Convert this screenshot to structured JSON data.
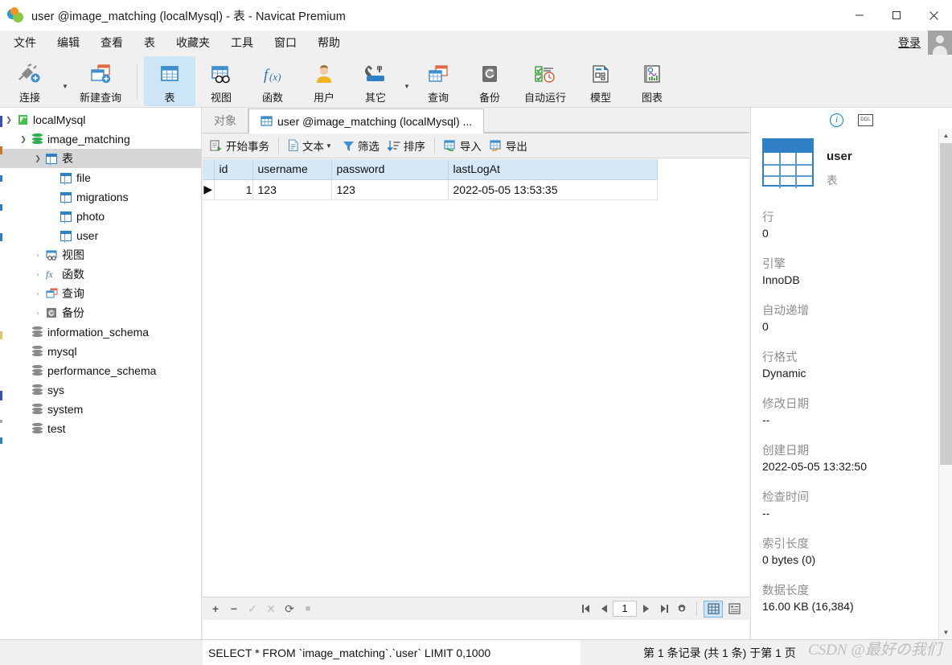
{
  "window": {
    "title": "user @image_matching (localMysql) - 表 - Navicat Premium",
    "app_icon": "navicat-logo-icon",
    "minimize": "minimize-icon",
    "maximize": "maximize-icon",
    "close": "close-icon"
  },
  "menubar": {
    "items": [
      {
        "label": "文件"
      },
      {
        "label": "编辑"
      },
      {
        "label": "查看"
      },
      {
        "label": "表"
      },
      {
        "label": "收藏夹"
      },
      {
        "label": "工具"
      },
      {
        "label": "窗口"
      },
      {
        "label": "帮助"
      }
    ],
    "login_label": "登录"
  },
  "toolbar": {
    "items": [
      {
        "label": "连接",
        "icon": "connection-icon",
        "active": false,
        "caret": true
      },
      {
        "label": "新建查询",
        "icon": "new-query-icon",
        "active": false,
        "caret": false
      },
      {
        "label": "表",
        "icon": "table-icon",
        "active": true,
        "caret": false
      },
      {
        "label": "视图",
        "icon": "view-icon",
        "active": false,
        "caret": false
      },
      {
        "label": "函数",
        "icon": "function-icon",
        "active": false,
        "caret": false
      },
      {
        "label": "用户",
        "icon": "user-icon",
        "active": false,
        "caret": false
      },
      {
        "label": "其它",
        "icon": "other-icon",
        "active": false,
        "caret": true
      },
      {
        "label": "查询",
        "icon": "query-icon",
        "active": false,
        "caret": false
      },
      {
        "label": "备份",
        "icon": "backup-icon",
        "active": false,
        "caret": false
      },
      {
        "label": "自动运行",
        "icon": "automation-icon",
        "active": false,
        "caret": false
      },
      {
        "label": "模型",
        "icon": "model-icon",
        "active": false,
        "caret": false
      },
      {
        "label": "图表",
        "icon": "chart-icon",
        "active": false,
        "caret": false
      }
    ]
  },
  "sidebar": {
    "nodes": [
      {
        "label": "localMysql",
        "icon": "connection-icon",
        "indent": 0,
        "twisty": "down",
        "selected": false
      },
      {
        "label": "image_matching",
        "icon": "database-green-icon",
        "indent": 1,
        "twisty": "down",
        "selected": false
      },
      {
        "label": "表",
        "icon": "table-folder-icon",
        "indent": 2,
        "twisty": "down",
        "selected": true
      },
      {
        "label": "file",
        "icon": "table-icon",
        "indent": 3,
        "twisty": "",
        "selected": false
      },
      {
        "label": "migrations",
        "icon": "table-icon",
        "indent": 3,
        "twisty": "",
        "selected": false
      },
      {
        "label": "photo",
        "icon": "table-icon",
        "indent": 3,
        "twisty": "",
        "selected": false
      },
      {
        "label": "user",
        "icon": "table-icon",
        "indent": 3,
        "twisty": "",
        "selected": false
      },
      {
        "label": "视图",
        "icon": "view-folder-icon",
        "indent": 2,
        "twisty": "right",
        "selected": false
      },
      {
        "label": "函数",
        "icon": "function-folder-icon",
        "indent": 2,
        "twisty": "right",
        "selected": false
      },
      {
        "label": "查询",
        "icon": "query-folder-icon",
        "indent": 2,
        "twisty": "right",
        "selected": false
      },
      {
        "label": "备份",
        "icon": "backup-folder-icon",
        "indent": 2,
        "twisty": "right",
        "selected": false
      },
      {
        "label": "information_schema",
        "icon": "database-icon",
        "indent": 1,
        "twisty": "",
        "selected": false
      },
      {
        "label": "mysql",
        "icon": "database-icon",
        "indent": 1,
        "twisty": "",
        "selected": false
      },
      {
        "label": "performance_schema",
        "icon": "database-icon",
        "indent": 1,
        "twisty": "",
        "selected": false
      },
      {
        "label": "sys",
        "icon": "database-icon",
        "indent": 1,
        "twisty": "",
        "selected": false
      },
      {
        "label": "system",
        "icon": "database-icon",
        "indent": 1,
        "twisty": "",
        "selected": false
      },
      {
        "label": "test",
        "icon": "database-icon",
        "indent": 1,
        "twisty": "",
        "selected": false
      }
    ]
  },
  "tabs": [
    {
      "label": "对象",
      "icon": "",
      "active": false
    },
    {
      "label": "user @image_matching (localMysql) ...",
      "icon": "table-icon",
      "active": true
    }
  ],
  "data_toolbar": {
    "items": [
      {
        "label": "开始事务",
        "icon": "transaction-icon",
        "caret": false
      },
      {
        "label": "文本",
        "icon": "text-icon",
        "caret": true
      },
      {
        "label": "筛选",
        "icon": "filter-icon",
        "caret": false
      },
      {
        "label": "排序",
        "icon": "sort-icon",
        "caret": false
      },
      {
        "label": "导入",
        "icon": "import-icon",
        "caret": false
      },
      {
        "label": "导出",
        "icon": "export-icon",
        "caret": false
      }
    ]
  },
  "grid": {
    "columns": [
      "id",
      "username",
      "password",
      "lastLogAt"
    ],
    "rows": [
      {
        "cells": [
          "1",
          "123",
          "123",
          "2022-05-05 13:53:35"
        ],
        "selected_col": 0,
        "marker": "▶"
      }
    ]
  },
  "grid_nav": {
    "add": "add-record-icon",
    "remove": "delete-record-icon",
    "apply": "apply-change-icon",
    "cancel": "cancel-change-icon",
    "refresh": "refresh-icon",
    "stop": "stop-icon",
    "first": "first-page-icon",
    "prev": "prev-page-icon",
    "page_value": "1",
    "next": "next-page-icon",
    "last": "last-page-icon",
    "settings": "gear-icon",
    "grid_view": "grid-view-icon",
    "form_view": "form-view-icon"
  },
  "info_panel": {
    "tab_info": "info-icon",
    "tab_ddl": "DDL",
    "object_name": "user",
    "object_type": "表",
    "fields": [
      {
        "key": "行",
        "value": "0"
      },
      {
        "key": "引擎",
        "value": "InnoDB"
      },
      {
        "key": "自动递增",
        "value": "0"
      },
      {
        "key": "行格式",
        "value": "Dynamic"
      },
      {
        "key": "修改日期",
        "value": "--"
      },
      {
        "key": "创建日期",
        "value": "2022-05-05 13:32:50"
      },
      {
        "key": "检查时间",
        "value": "--"
      },
      {
        "key": "索引长度",
        "value": "0 bytes (0)"
      },
      {
        "key": "数据长度",
        "value": "16.00 KB (16,384)"
      }
    ]
  },
  "status_bar": {
    "sql": "SELECT * FROM `image_matching`.`user` LIMIT 0,1000",
    "record_info": "第 1 条记录 (共 1 条) 于第 1 页"
  },
  "watermark": {
    "text": "CSDN @最好の我们"
  },
  "colors": {
    "accent": "#0c7cd5",
    "header_bg": "#d6e7f7",
    "toolbar_active": "#cde6f7",
    "chrome": "#f0f0f0"
  }
}
